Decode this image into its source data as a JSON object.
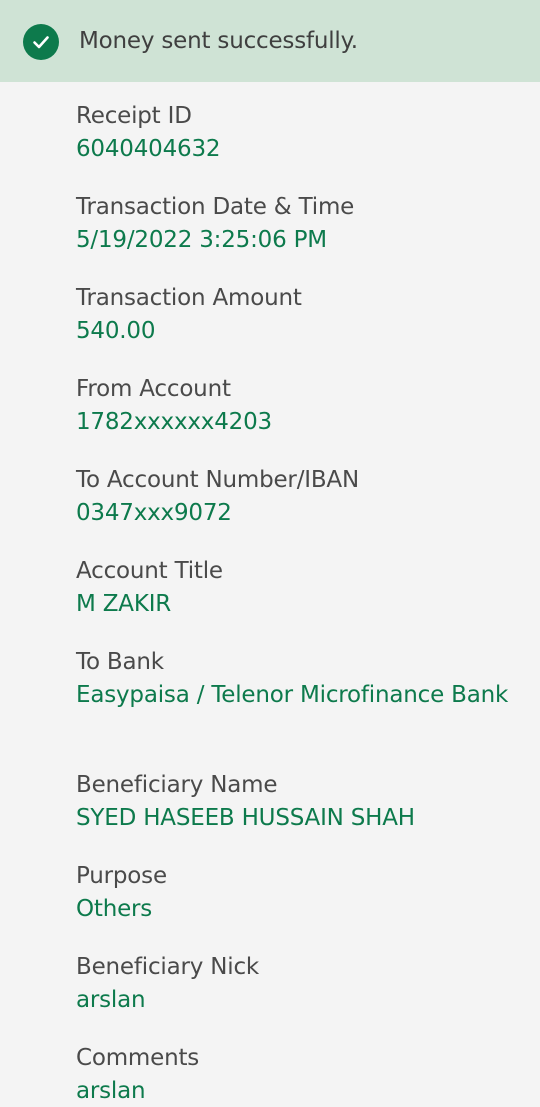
{
  "banner": {
    "message": "Money sent successfully.",
    "icon": "check-circle-icon",
    "accent": "#0d7a4c"
  },
  "details": [
    {
      "label": "Receipt ID",
      "value": "6040404632"
    },
    {
      "label": "Transaction Date & Time",
      "value": "5/19/2022 3:25:06 PM"
    },
    {
      "label": "Transaction Amount",
      "value": "540.00"
    },
    {
      "label": "From Account",
      "value": "1782xxxxxx4203"
    },
    {
      "label": "To Account Number/IBAN",
      "value": "0347xxx9072"
    },
    {
      "label": "Account Title",
      "value": "M ZAKIR"
    },
    {
      "label": "To Bank",
      "value": "Easypaisa / Telenor Microfinance Bank"
    },
    {
      "label": "Beneficiary Name",
      "value": "SYED HASEEB HUSSAIN SHAH"
    },
    {
      "label": "Purpose",
      "value": "Others"
    },
    {
      "label": "Beneficiary Nick",
      "value": "arslan"
    },
    {
      "label": "Comments",
      "value": "arslan"
    }
  ]
}
